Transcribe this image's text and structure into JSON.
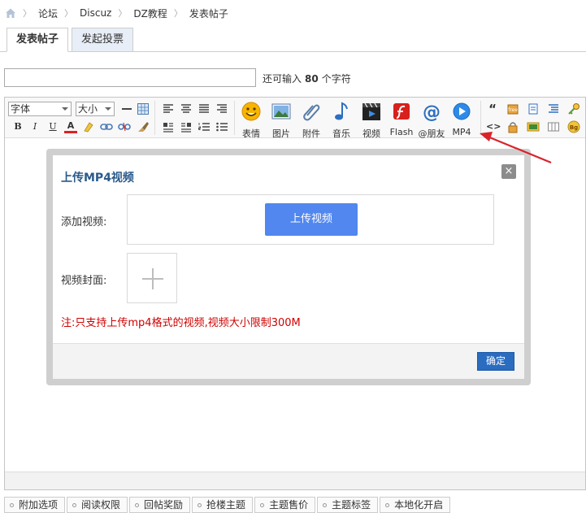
{
  "breadcrumb": {
    "items": [
      "论坛",
      "Discuz",
      "DZ教程",
      "发表帖子"
    ]
  },
  "tabs": [
    {
      "label": "发表帖子",
      "active": true
    },
    {
      "label": "发起投票",
      "active": false
    }
  ],
  "title_field": {
    "value": "",
    "counter_prefix": "还可输入",
    "counter_value": "80",
    "counter_suffix": "个字符"
  },
  "toolbar": {
    "font_select": "字体",
    "size_select": "大小",
    "buttons": [
      {
        "label": "表情",
        "icon": "smiley-icon"
      },
      {
        "label": "图片",
        "icon": "image-icon"
      },
      {
        "label": "附件",
        "icon": "paperclip-icon"
      },
      {
        "label": "音乐",
        "icon": "music-note-icon"
      },
      {
        "label": "视频",
        "icon": "film-icon"
      },
      {
        "label": "Flash",
        "icon": "flash-icon"
      },
      {
        "label": "@朋友",
        "icon": "at-icon"
      },
      {
        "label": "MP4",
        "icon": "play-circle-icon"
      }
    ],
    "small_icons": {
      "bold": "B",
      "italic": "I",
      "underline": "U",
      "text_color": "A",
      "quote": "“",
      "code": "<>",
      "bg": "Bg"
    }
  },
  "modal": {
    "title": "上传MP4视频",
    "close_glyph": "×",
    "add_video_label": "添加视频:",
    "upload_button": "上传视频",
    "cover_label": "视频封面:",
    "cover_plus": "+",
    "note": "注:只支持上传mp4格式的视频,视频大小限制300M",
    "ok_button": "确定"
  },
  "options": [
    "附加选项",
    "阅读权限",
    "回帖奖励",
    "抢楼主题",
    "主题售价",
    "主题标签",
    "本地化开启"
  ],
  "colors": {
    "accent_blue": "#5187ef",
    "ok_blue": "#2a6cbf",
    "note_red": "#d00000",
    "title_blue": "#2a5a8a",
    "arrow_red": "#d9232a"
  }
}
